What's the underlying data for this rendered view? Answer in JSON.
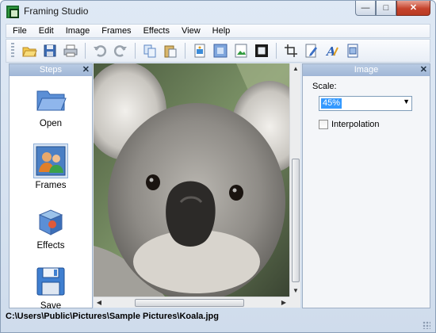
{
  "window": {
    "title": "Framing Studio",
    "buttons": {
      "minimize": "—",
      "maximize": "□",
      "close": "✕"
    }
  },
  "menu": [
    "File",
    "Edit",
    "Image",
    "Frames",
    "Effects",
    "View",
    "Help"
  ],
  "toolbar": {
    "icons": [
      "open-folder-icon",
      "save-disk-icon",
      "print-icon",
      "undo-icon",
      "redo-icon",
      "copy-icon",
      "paste-icon",
      "add-image-icon",
      "frame-icon",
      "picture-icon",
      "border-frame-icon",
      "crop-icon",
      "edit-document-icon",
      "text-icon",
      "page-fit-icon"
    ]
  },
  "steps_panel": {
    "title": "Steps",
    "close": "✕",
    "items": [
      {
        "label": "Open",
        "icon": "folder-icon"
      },
      {
        "label": "Frames",
        "icon": "frames-people-icon",
        "active": true
      },
      {
        "label": "Effects",
        "icon": "effects-box-icon"
      },
      {
        "label": "Save",
        "icon": "floppy-disk-icon"
      }
    ]
  },
  "image_panel": {
    "title": "Image",
    "close": "✕",
    "scale_label": "Scale:",
    "scale_value": "45%",
    "interpolation_label": "Interpolation",
    "interpolation_checked": false
  },
  "canvas": {
    "subject": "koala-photo"
  },
  "status": {
    "path": "C:\\Users\\Public\\Pictures\\Sample Pictures\\Koala.jpg"
  },
  "colors": {
    "accent": "#3399ff",
    "panel_header": "#a9bfdc",
    "close_button": "#c5432c"
  }
}
